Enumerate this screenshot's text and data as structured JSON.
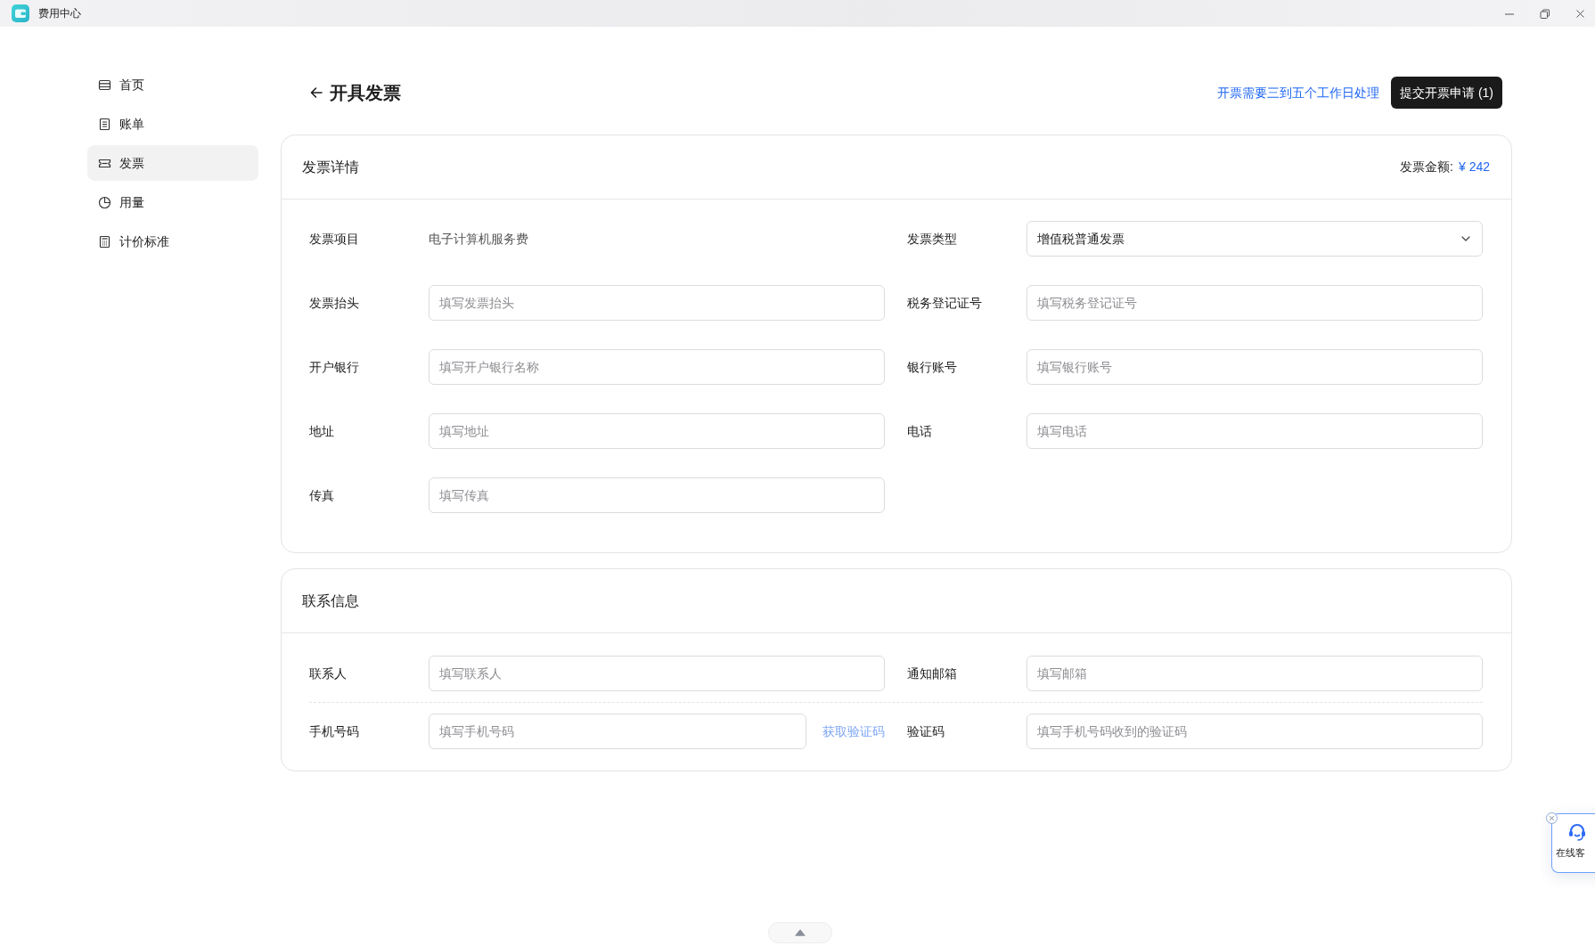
{
  "window": {
    "title": "费用中心"
  },
  "sidebar": {
    "items": [
      {
        "label": "首页",
        "kind": "home",
        "selected": false
      },
      {
        "label": "账单",
        "kind": "bill",
        "selected": false
      },
      {
        "label": "发票",
        "kind": "invoice",
        "selected": true
      },
      {
        "label": "用量",
        "kind": "usage",
        "selected": false
      },
      {
        "label": "计价标准",
        "kind": "pricing",
        "selected": false
      }
    ]
  },
  "page": {
    "title": "开具发票",
    "notice": "开票需要三到五个工作日处理",
    "submit_button": "提交开票申请 (1)"
  },
  "invoice_details": {
    "title": "发票详情",
    "amount_label": "发票金额:",
    "amount": "¥ 242",
    "fields": [
      {
        "label": "发票项目",
        "kind": "text",
        "value": "电子计算机服务费"
      },
      {
        "label": "发票类型",
        "kind": "select",
        "value": "增值税普通发票"
      },
      {
        "label": "发票抬头",
        "kind": "input",
        "placeholder": "填写发票抬头"
      },
      {
        "label": "税务登记证号",
        "kind": "input",
        "placeholder": "填写税务登记证号"
      },
      {
        "label": "开户银行",
        "kind": "input",
        "placeholder": "填写开户银行名称"
      },
      {
        "label": "银行账号",
        "kind": "input",
        "placeholder": "填写银行账号"
      },
      {
        "label": "地址",
        "kind": "input",
        "placeholder": "填写地址"
      },
      {
        "label": "电话",
        "kind": "input",
        "placeholder": "填写电话"
      },
      {
        "label": "传真",
        "kind": "input",
        "placeholder": "填写传真"
      }
    ]
  },
  "contact_info": {
    "title": "联系信息",
    "fields": [
      {
        "label": "联系人",
        "kind": "input",
        "placeholder": "填写联系人"
      },
      {
        "label": "通知邮箱",
        "kind": "input",
        "placeholder": "填写邮箱"
      },
      {
        "label": "手机号码",
        "kind": "input_action",
        "placeholder": "填写手机号码",
        "action": {
          "label": "获取验证码",
          "disabled": true
        }
      },
      {
        "label": "验证码",
        "kind": "input",
        "placeholder": "填写手机号码收到的验证码"
      }
    ]
  },
  "support_widget": {
    "label": "在线客"
  }
}
